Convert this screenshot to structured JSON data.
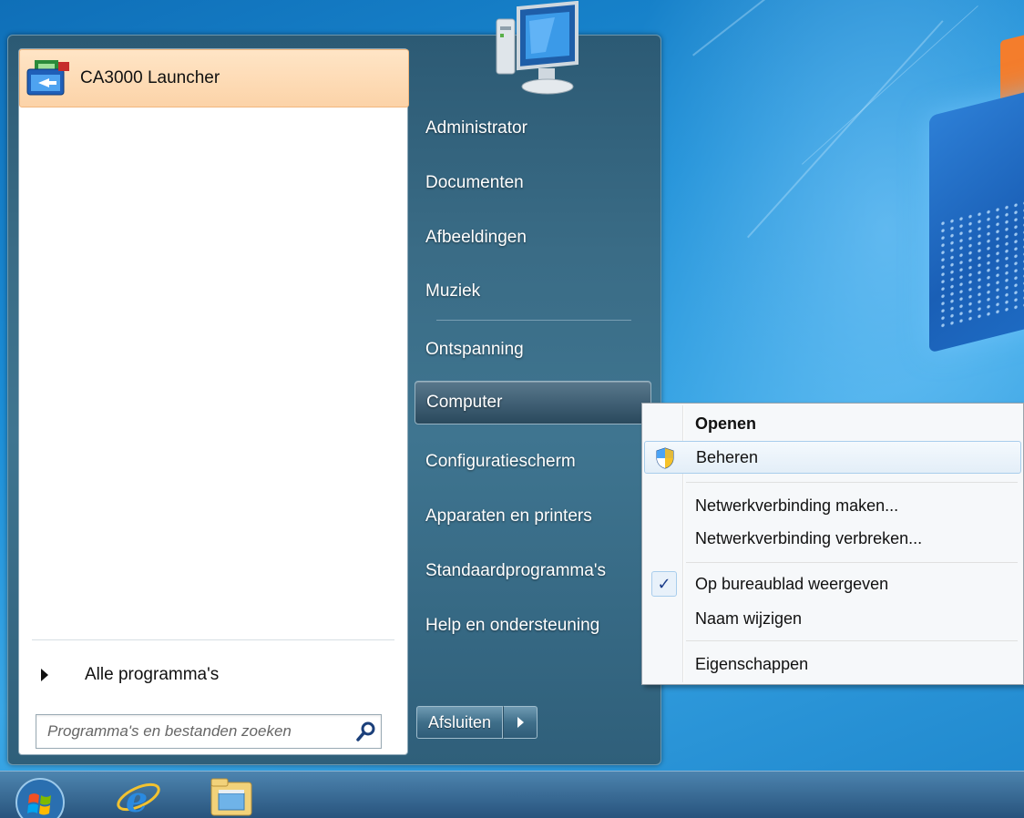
{
  "start_menu": {
    "pinned": [
      {
        "label": "CA3000 Launcher",
        "icon": "ca3000-launcher-icon"
      }
    ],
    "all_programs_label": "Alle programma's",
    "search_placeholder": "Programma's en bestanden zoeken",
    "right_items": [
      {
        "label": "Administrator"
      },
      {
        "label": "Documenten"
      },
      {
        "label": "Afbeeldingen"
      },
      {
        "label": "Muziek"
      },
      {
        "label": "Ontspanning"
      },
      {
        "label": "Computer",
        "active": true
      },
      {
        "label": "Configuratiescherm"
      },
      {
        "label": "Apparaten en printers"
      },
      {
        "label": "Standaardprogramma's"
      },
      {
        "label": "Help en ondersteuning"
      }
    ],
    "shutdown_label": "Afsluiten"
  },
  "context_menu": {
    "items": [
      {
        "label": "Openen",
        "bold": true
      },
      {
        "label": "Beheren",
        "icon": "uac-shield-icon",
        "hover": true
      },
      {
        "label": "Netwerkverbinding maken..."
      },
      {
        "label": "Netwerkverbinding verbreken..."
      },
      {
        "label": "Op bureaublad weergeven",
        "checked": true
      },
      {
        "label": "Naam wijzigen"
      },
      {
        "label": "Eigenschappen"
      }
    ]
  },
  "taskbar": {
    "items": [
      "start-orb-icon",
      "internet-explorer-icon",
      "windows-explorer-icon"
    ]
  },
  "colors": {
    "accent_hover": "#fcd3a8",
    "menu_bg": "#3a6c86",
    "desktop": "#1c8ed6"
  }
}
